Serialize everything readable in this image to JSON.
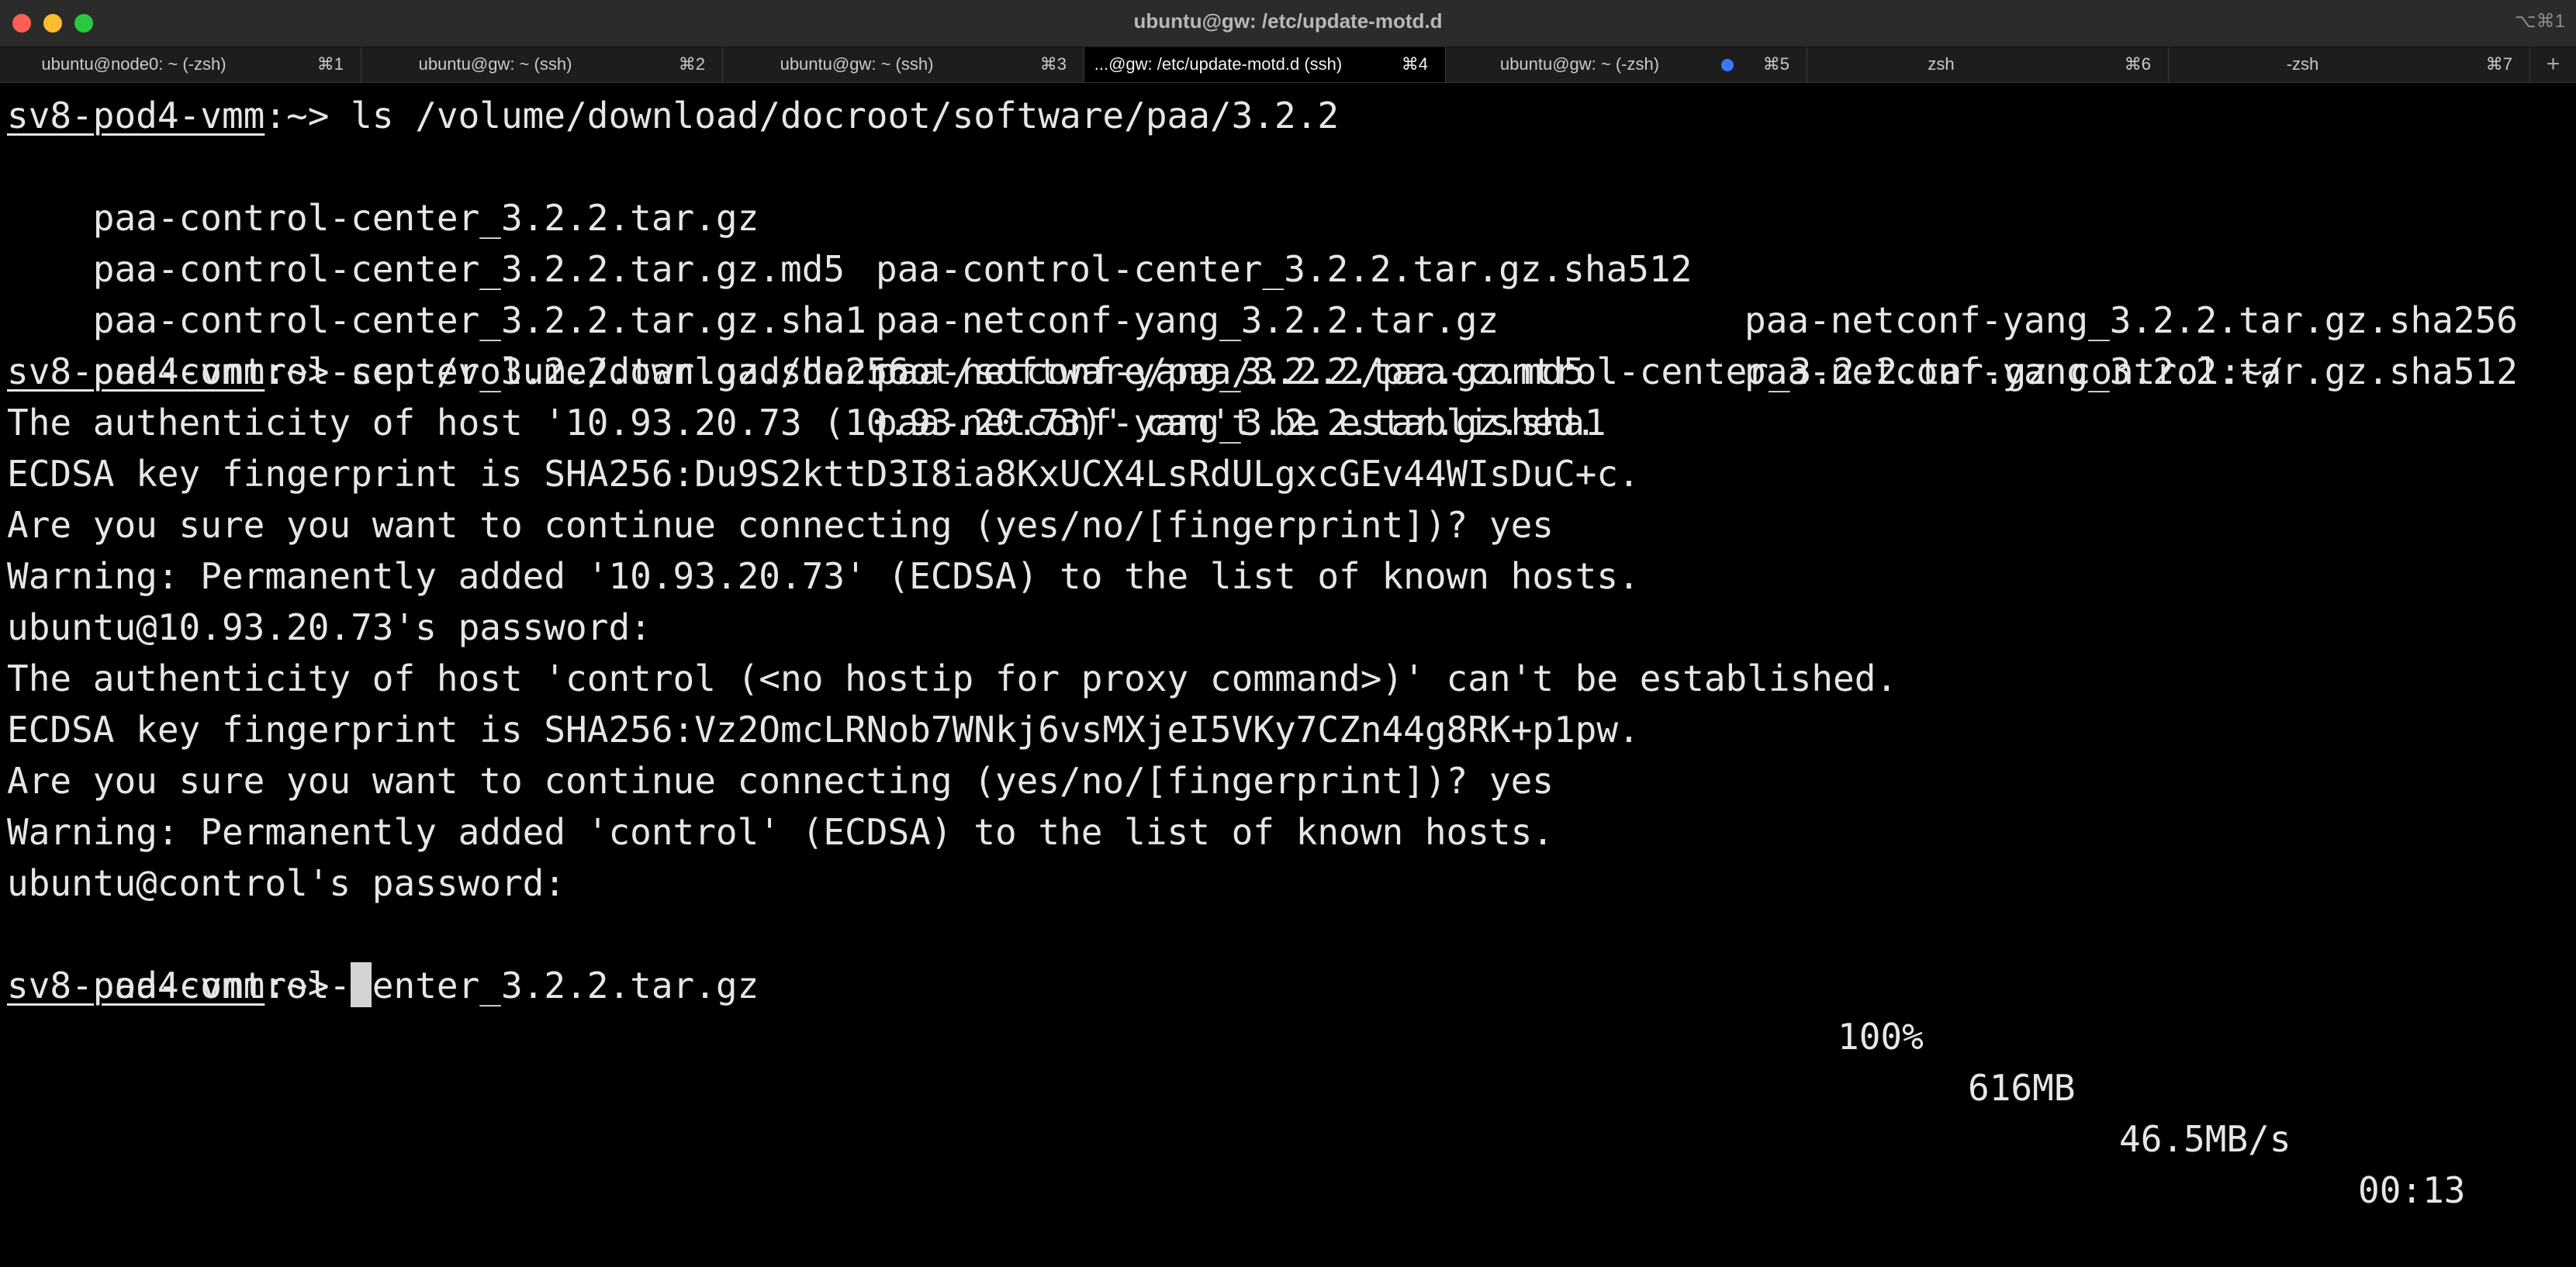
{
  "window": {
    "title": "ubuntu@gw: /etc/update-motd.d",
    "shortcut": "⌥⌘1"
  },
  "tabs": [
    {
      "title": "ubuntu@node0: ~ (-zsh)",
      "shortcut": "⌘1",
      "active": false
    },
    {
      "title": "ubuntu@gw: ~ (ssh)",
      "shortcut": "⌘2",
      "active": false
    },
    {
      "title": "ubuntu@gw: ~ (ssh)",
      "shortcut": "⌘3",
      "active": false
    },
    {
      "title": "...@gw: /etc/update-motd.d (ssh)",
      "shortcut": "⌘4",
      "active": true
    },
    {
      "title": "ubuntu@gw: ~ (-zsh)",
      "shortcut": "⌘5",
      "active": false,
      "activity_dot": true
    },
    {
      "title": "zsh",
      "shortcut": "⌘6",
      "active": false
    },
    {
      "title": "-zsh",
      "shortcut": "⌘7",
      "active": false
    }
  ],
  "new_tab_label": "+",
  "colors": {
    "activity_dot": "#3b78ff",
    "close": "#ff5f57",
    "minimize": "#febc2e",
    "maximize": "#28c840"
  },
  "terminal": {
    "prompt": "sv8-pod4-vmm",
    "prompt_suffix": ":~> ",
    "commands": {
      "ls": "ls /volume/download/docroot/software/paa/3.2.2",
      "scp": "scp /volume/download/docroot/software/paa/3.2.2/paa-control-center_3.2.2.tar.gz control:~/"
    },
    "ls_output": [
      [
        "paa-control-center_3.2.2.tar.gz",
        "paa-control-center_3.2.2.tar.gz.sha512",
        "paa-netconf-yang_3.2.2.tar.gz.sha256"
      ],
      [
        "paa-control-center_3.2.2.tar.gz.md5",
        "paa-netconf-yang_3.2.2.tar.gz",
        "paa-netconf-yang_3.2.2.tar.gz.sha512"
      ],
      [
        "paa-control-center_3.2.2.tar.gz.sha1",
        "paa-netconf-yang_3.2.2.tar.gz.md5",
        ""
      ],
      [
        "paa-control-center_3.2.2.tar.gz.sha256",
        "paa-netconf-yang_3.2.2.tar.gz.sha1",
        ""
      ]
    ],
    "scp_output": [
      "The authenticity of host '10.93.20.73 (10.93.20.73)' can't be established.",
      "ECDSA key fingerprint is SHA256:Du9S2kttD3I8ia8KxUCX4LsRdULgxcGEv44WIsDuC+c.",
      "Are you sure you want to continue connecting (yes/no/[fingerprint])? yes",
      "Warning: Permanently added '10.93.20.73' (ECDSA) to the list of known hosts.",
      "ubuntu@10.93.20.73's password:",
      "The authenticity of host 'control (<no hostip for proxy command>)' can't be established.",
      "ECDSA key fingerprint is SHA256:Vz2OmcLRNob7WNkj6vsMXjeI5VKy7CZn44g8RK+p1pw.",
      "Are you sure you want to continue connecting (yes/no/[fingerprint])? yes",
      "Warning: Permanently added 'control' (ECDSA) to the list of known hosts.",
      "ubuntu@control's password:"
    ],
    "progress": {
      "file": "paa-control-center_3.2.2.tar.gz",
      "percent": "100%",
      "size": "616MB",
      "rate": "46.5MB/s",
      "time": "00:13"
    }
  }
}
